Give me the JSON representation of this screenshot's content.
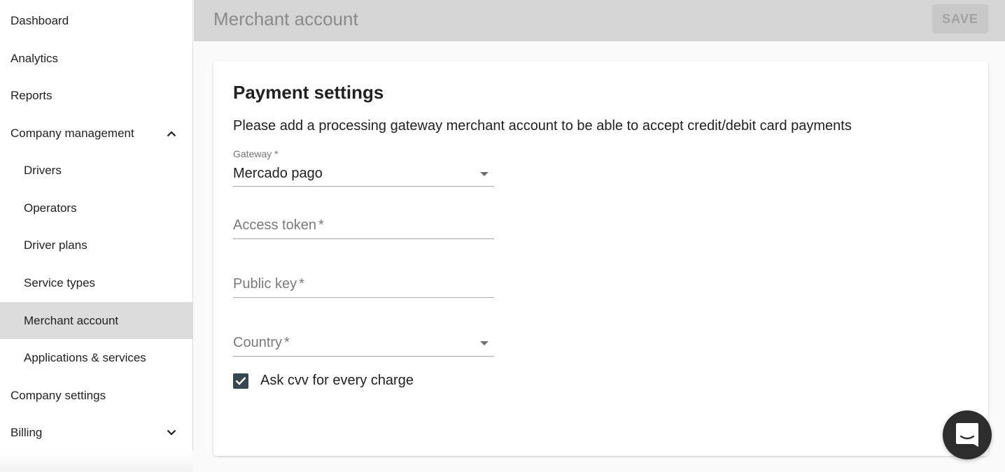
{
  "sidebar": {
    "items": [
      {
        "label": "Dashboard"
      },
      {
        "label": "Analytics"
      },
      {
        "label": "Reports"
      },
      {
        "label": "Company management",
        "expanded": true
      },
      {
        "label": "Drivers"
      },
      {
        "label": "Operators"
      },
      {
        "label": "Driver plans"
      },
      {
        "label": "Service types"
      },
      {
        "label": "Merchant account",
        "active": true
      },
      {
        "label": "Applications & services"
      },
      {
        "label": "Company settings"
      },
      {
        "label": "Billing",
        "expanded": false
      }
    ]
  },
  "header": {
    "title": "Merchant account",
    "save_label": "SAVE"
  },
  "card": {
    "title": "Payment settings",
    "description": "Please add a processing gateway merchant account to be able to accept credit/debit card payments",
    "gateway": {
      "label": "Gateway *",
      "value": "Mercado pago"
    },
    "access_token": {
      "placeholder": "Access token",
      "required_mark": "*"
    },
    "public_key": {
      "placeholder": "Public key",
      "required_mark": "*"
    },
    "country": {
      "placeholder": "Country",
      "required_mark": "*"
    },
    "ask_cvv": {
      "label": "Ask cvv for every charge",
      "checked": true
    }
  },
  "icons": {
    "expand": "chevron-up-icon",
    "collapse": "chevron-down-icon",
    "dropdown": "caret-down-icon",
    "check": "check-icon",
    "chat": "chat-bubble-icon"
  },
  "colors": {
    "checkbox": "#37474f",
    "active_nav": "#dcdcdc",
    "topbar": "#d5d5d5",
    "chat_fab": "#2d2d2d"
  }
}
